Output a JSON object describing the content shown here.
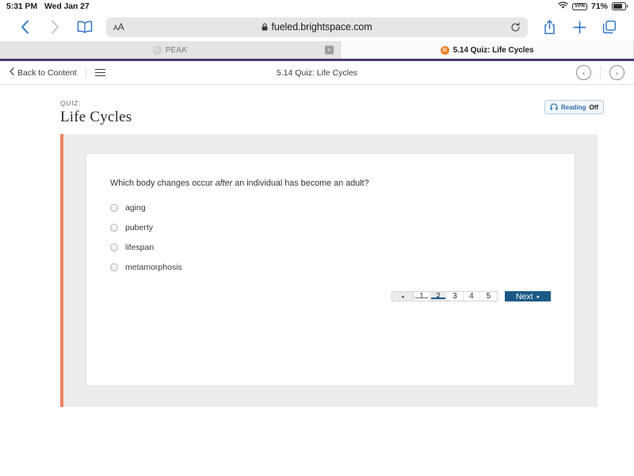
{
  "status_bar": {
    "time": "5:31 PM",
    "date": "Wed Jan 27",
    "vpn_label": "VPN",
    "battery_percent": "71%",
    "wifi_icon": "wifi-icon",
    "battery_icon": "battery-icon"
  },
  "browser": {
    "back_icon": "chevron-left-icon",
    "forward_icon": "chevron-right-icon",
    "bookmarks_icon": "book-icon",
    "text_size_label_big": "A",
    "text_size_label_small": "A",
    "lock_icon": "lock-icon",
    "url": "fueled.brightspace.com",
    "reload_icon": "reload-icon",
    "share_icon": "share-icon",
    "new_tab_icon": "plus-icon",
    "tabs_icon": "tabs-overview-icon",
    "tabs": [
      {
        "title": "PEAK",
        "favicon_letter": "G",
        "favicon_name": "peak-favicon",
        "active": false,
        "close_label": "×"
      },
      {
        "title": "5.14 Quiz: Life Cycles",
        "favicon_letter": "D",
        "favicon_name": "brightspace-favicon",
        "active": true
      }
    ]
  },
  "lms_nav": {
    "back_label": "Back to Content",
    "back_chevron": "chevron-left-icon",
    "menu_icon": "hamburger-menu-icon",
    "title": "5.14 Quiz: Life Cycles",
    "prev_icon": "‹",
    "next_icon": "›"
  },
  "quiz": {
    "kicker": "QUIZ:",
    "title": "Life Cycles",
    "reading_toggle": {
      "icon": "headphones-icon",
      "label": "Reading",
      "state": "Off"
    },
    "question": {
      "prefix": "Which body changes occur ",
      "emphasis": "after",
      "suffix": " an individual has become an adult?"
    },
    "options": [
      {
        "label": "aging",
        "selected": false
      },
      {
        "label": "puberty",
        "selected": false
      },
      {
        "label": "lifespan",
        "selected": false
      },
      {
        "label": "metamorphosis",
        "selected": false
      }
    ],
    "pagination": {
      "prev_icon": "◂",
      "pages": [
        {
          "number": "1",
          "state": "visited"
        },
        {
          "number": "2",
          "state": "active"
        },
        {
          "number": "3",
          "state": "default"
        },
        {
          "number": "4",
          "state": "default"
        },
        {
          "number": "5",
          "state": "default"
        }
      ],
      "next_label": "Next",
      "next_caret": "▸"
    }
  },
  "colors": {
    "accent_orange": "#ef8361",
    "brightspace_orange": "#e8832b",
    "next_button_blue": "#1b5a86",
    "active_page_blue": "#1e5c8a",
    "safari_blue": "#3478c6",
    "tab_underline_purple": "#4b3a6b"
  }
}
